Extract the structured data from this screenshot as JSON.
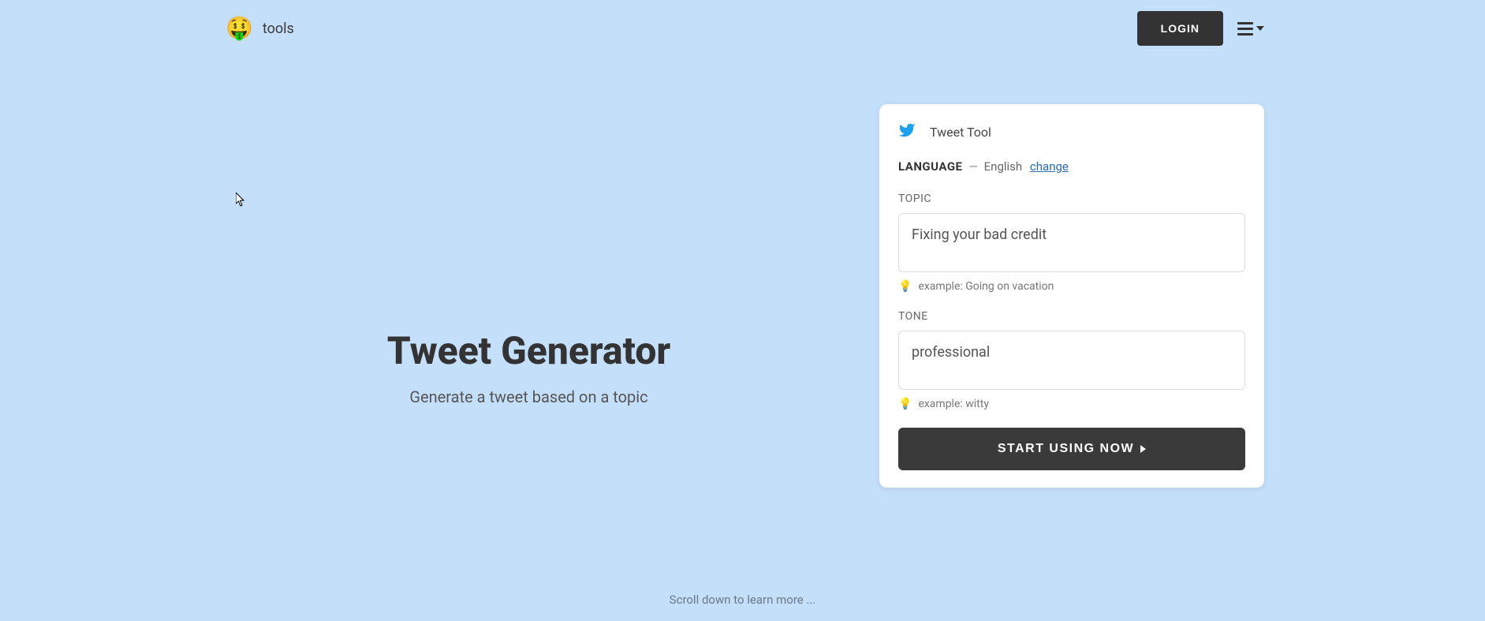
{
  "header": {
    "logo_emoji": "🤑",
    "tools_label": "tools",
    "login_label": "LOGIN"
  },
  "hero": {
    "title": "Tweet Generator",
    "subtitle": "Generate a tweet based on a topic"
  },
  "card": {
    "title": "Tweet Tool",
    "language": {
      "label": "LANGUAGE",
      "value": "English",
      "change_label": "change"
    },
    "topic": {
      "label": "TOPIC",
      "value": "Fixing your bad credit",
      "hint": "example: Going on vacation"
    },
    "tone": {
      "label": "TONE",
      "value": "professional",
      "hint": "example: witty"
    },
    "cta_label": "START USING NOW"
  },
  "scroll_hint": "Scroll down to learn more ..."
}
